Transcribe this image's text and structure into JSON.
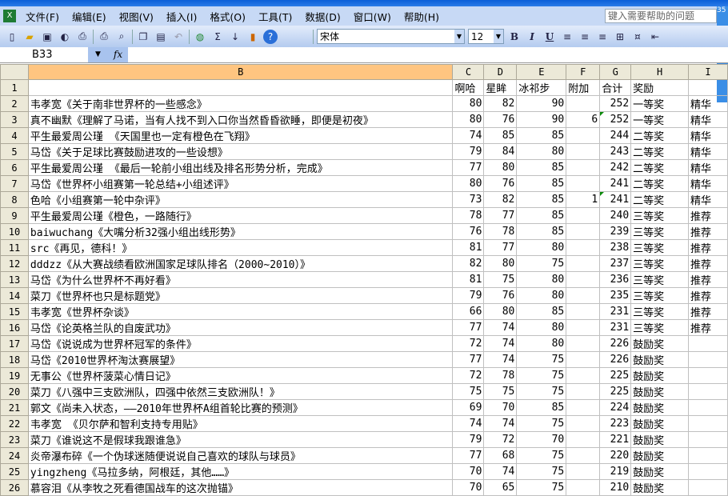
{
  "menu": [
    "文件(F)",
    "编辑(E)",
    "视图(V)",
    "插入(I)",
    "格式(O)",
    "工具(T)",
    "数据(D)",
    "窗口(W)",
    "帮助(H)"
  ],
  "help_placeholder": "键入需要帮助的问题",
  "help_tag": "35",
  "toolbar": {
    "font": "宋体",
    "size": "12",
    "bold": "B",
    "italic": "I",
    "underline": "U",
    "sigma": "Σ"
  },
  "namebox": "B33",
  "fx": "fx",
  "columns": [
    "B",
    "C",
    "D",
    "E",
    "F",
    "G",
    "H",
    "I"
  ],
  "header_row": [
    "",
    "啊哈",
    "星眸",
    "冰祁步",
    "附加",
    "合计",
    "奖励",
    ""
  ],
  "rows": [
    [
      "韦孝宽《关于南非世界杯的一些感念》",
      80,
      82,
      90,
      "",
      252,
      "一等奖",
      "精华"
    ],
    [
      "真不幽默《理解了马诺，当有人找不到入口你当然昏昏欲睡，即便是初夜》",
      80,
      76,
      90,
      6,
      252,
      "一等奖",
      "精华"
    ],
    [
      "平生最爱周公瑾 《天国里也一定有橙色在飞翔》",
      74,
      85,
      85,
      "",
      244,
      "二等奖",
      "精华"
    ],
    [
      "马岱《关于足球比赛鼓励进攻的一些设想》",
      79,
      84,
      80,
      "",
      243,
      "二等奖",
      "精华"
    ],
    [
      "平生最爱周公瑾 《最后一轮前小组出线及排名形势分析，完成》",
      77,
      80,
      85,
      "",
      242,
      "二等奖",
      "精华"
    ],
    [
      "马岱《世界杯小组赛第一轮总结+小组述评》",
      80,
      76,
      85,
      "",
      241,
      "二等奖",
      "精华"
    ],
    [
      "色哈《小组赛第一轮中杂评》",
      73,
      82,
      85,
      1,
      241,
      "二等奖",
      "精华"
    ],
    [
      "平生最爱周公瑾《橙色，一路随行》",
      78,
      77,
      85,
      "",
      240,
      "三等奖",
      "推荐"
    ],
    [
      "baiwuchang《大嘴分析32强小组出线形势》",
      76,
      78,
      85,
      "",
      239,
      "三等奖",
      "推荐"
    ],
    [
      "src《再见，德科！》",
      81,
      77,
      80,
      "",
      238,
      "三等奖",
      "推荐"
    ],
    [
      "dddzz《从大赛战绩看欧洲国家足球队排名（2000~2010）》",
      82,
      80,
      75,
      "",
      237,
      "三等奖",
      "推荐"
    ],
    [
      "马岱《为什么世界杯不再好看》",
      81,
      75,
      80,
      "",
      236,
      "三等奖",
      "推荐"
    ],
    [
      "菜刀《世界杯也只是标题党》",
      79,
      76,
      80,
      "",
      235,
      "三等奖",
      "推荐"
    ],
    [
      "韦孝宽《世界杯杂谈》",
      66,
      80,
      85,
      "",
      231,
      "三等奖",
      "推荐"
    ],
    [
      "马岱《论英格兰队的自废武功》",
      77,
      74,
      80,
      "",
      231,
      "三等奖",
      "推荐"
    ],
    [
      "马岱《说说成为世界杯冠军的条件》",
      72,
      74,
      80,
      "",
      226,
      "鼓励奖",
      ""
    ],
    [
      "马岱《2010世界杯淘汰赛展望》",
      77,
      74,
      75,
      "",
      226,
      "鼓励奖",
      ""
    ],
    [
      "无事公《世界杯菠菜心情日记》",
      72,
      78,
      75,
      "",
      225,
      "鼓励奖",
      ""
    ],
    [
      "菜刀《八强中三支欧洲队，四强中依然三支欧洲队！》",
      75,
      75,
      75,
      "",
      225,
      "鼓励奖",
      ""
    ],
    [
      "郭文《尚未入状态，——2010年世界杯A组首轮比赛的预测》",
      69,
      70,
      85,
      "",
      224,
      "鼓励奖",
      ""
    ],
    [
      "韦孝宽 《贝尔萨和智利支持专用贴》",
      74,
      74,
      75,
      "",
      223,
      "鼓励奖",
      ""
    ],
    [
      "菜刀《谁说这不是假球我跟谁急》",
      79,
      72,
      70,
      "",
      221,
      "鼓励奖",
      ""
    ],
    [
      "炎帝瀑布碎《一个伪球迷随便说说自己喜欢的球队与球员》",
      77,
      68,
      75,
      "",
      220,
      "鼓励奖",
      ""
    ],
    [
      "yingzheng《马拉多纳，阿根廷，其他……》",
      70,
      74,
      75,
      "",
      219,
      "鼓励奖",
      ""
    ],
    [
      "慕容泪《从李牧之死看德国战车的这次抛锚》",
      70,
      65,
      75,
      "",
      210,
      "鼓励奖",
      ""
    ]
  ]
}
